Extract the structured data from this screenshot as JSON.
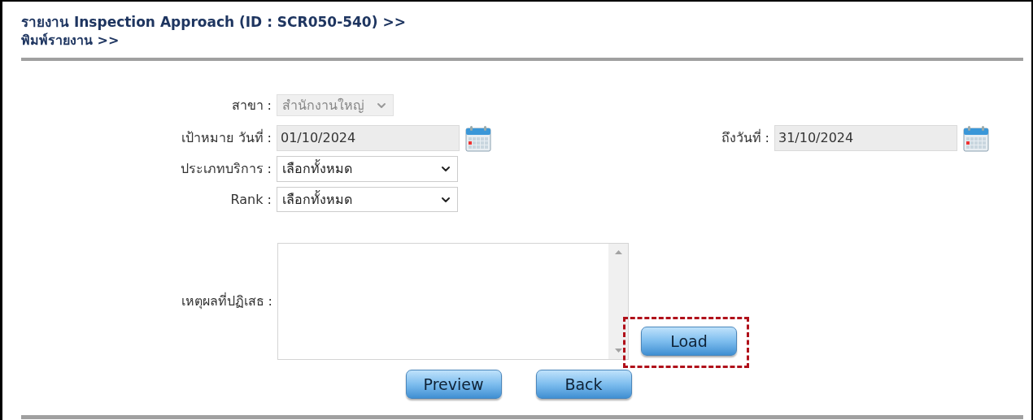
{
  "header": {
    "title": "รายงาน Inspection Approach (ID : SCR050-540) >>",
    "subtitle": "พิมพ์รายงาน >>"
  },
  "form": {
    "branch": {
      "label": "สาขา :",
      "value": "สำนักงานใหญ่",
      "disabled": true
    },
    "date_from": {
      "label": "เป้าหมาย วันที่ :",
      "value": "01/10/2024"
    },
    "date_to": {
      "label": "ถึงวันที่ :",
      "value": "31/10/2024"
    },
    "service_type": {
      "label": "ประเภทบริการ :",
      "value": "เลือกทั้งหมด",
      "disabled": false
    },
    "rank": {
      "label": "Rank :",
      "value": "เลือกทั้งหมด",
      "disabled": false
    },
    "reject_reason": {
      "label": "เหตุผลที่ปฏิเสธ :"
    }
  },
  "buttons": [
    {
      "label": "Load",
      "highlighted": true
    },
    {
      "label": "Preview",
      "highlighted": false
    },
    {
      "label": "Back",
      "highlighted": false
    }
  ]
}
